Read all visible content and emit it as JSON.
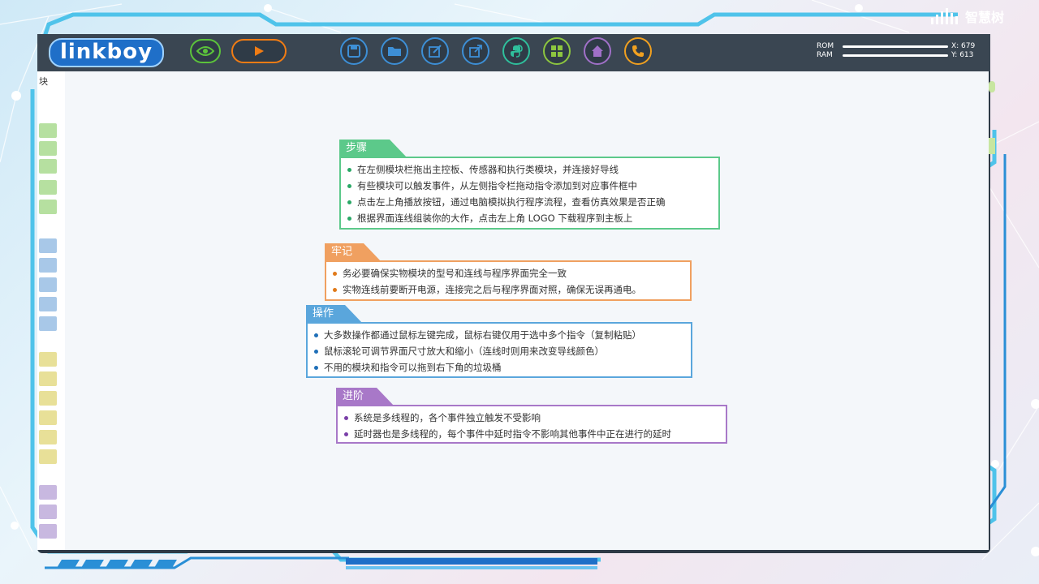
{
  "app": {
    "logo_text": "linkboy",
    "brand_text": "智慧树"
  },
  "toolbar": {
    "buttons": [
      {
        "name": "view-button",
        "icon": "eye-icon",
        "color": "#5cc33b"
      },
      {
        "name": "play-button",
        "icon": "play-icon",
        "color": "#f07c14"
      },
      {
        "name": "save-button",
        "icon": "floppy-icon",
        "color": "#3d8fd6"
      },
      {
        "name": "open-button",
        "icon": "folder-icon",
        "color": "#3d8fd6"
      },
      {
        "name": "edit-button",
        "icon": "edit-icon",
        "color": "#3d8fd6"
      },
      {
        "name": "export-button",
        "icon": "export-icon",
        "color": "#3d8fd6"
      },
      {
        "name": "python-button",
        "icon": "python-icon",
        "color": "#2fbf9c"
      },
      {
        "name": "grid-button",
        "icon": "grid-icon",
        "color": "#8dc63f"
      },
      {
        "name": "home-button",
        "icon": "home-icon",
        "color": "#a070c8"
      },
      {
        "name": "phone-button",
        "icon": "phone-icon",
        "color": "#f0a020"
      }
    ]
  },
  "stats": {
    "rom_label": "ROM",
    "ram_label": "RAM",
    "x_value": "X: 679",
    "y_value": "Y: 613"
  },
  "left_panel": {
    "tab_label": "块"
  },
  "cards": {
    "steps": {
      "title": "步骤",
      "color": "#5cc98a",
      "items": [
        "在左侧模块栏拖出主控板、传感器和执行类模块，并连接好导线",
        "有些模块可以触发事件，从左侧指令栏拖动指令添加到对应事件框中",
        "点击左上角播放按钮，通过电脑模拟执行程序流程，查看仿真效果是否正确",
        "根据界面连线组装你的大作，点击左上角 LOGO 下载程序到主板上"
      ]
    },
    "remember": {
      "title": "牢记",
      "color": "#f0a060",
      "items": [
        "务必要确保实物模块的型号和连线与程序界面完全一致",
        "实物连线前要断开电源，连接完之后与程序界面对照，确保无误再通电。"
      ]
    },
    "operate": {
      "title": "操作",
      "color": "#5aa6dc",
      "items": [
        "大多数操作都通过鼠标左键完成，鼠标右键仅用于选中多个指令（复制粘贴）",
        "鼠标滚轮可调节界面尺寸放大和缩小（连线时则用来改变导线颜色）",
        "不用的模块和指令可以拖到右下角的垃圾桶"
      ]
    },
    "advanced": {
      "title": "进阶",
      "color": "#a878c8",
      "items": [
        "系统是多线程的，各个事件独立触发不受影响",
        "延时器也是多线程的，每个事件中延时指令不影响其他事件中正在进行的延时"
      ]
    }
  }
}
